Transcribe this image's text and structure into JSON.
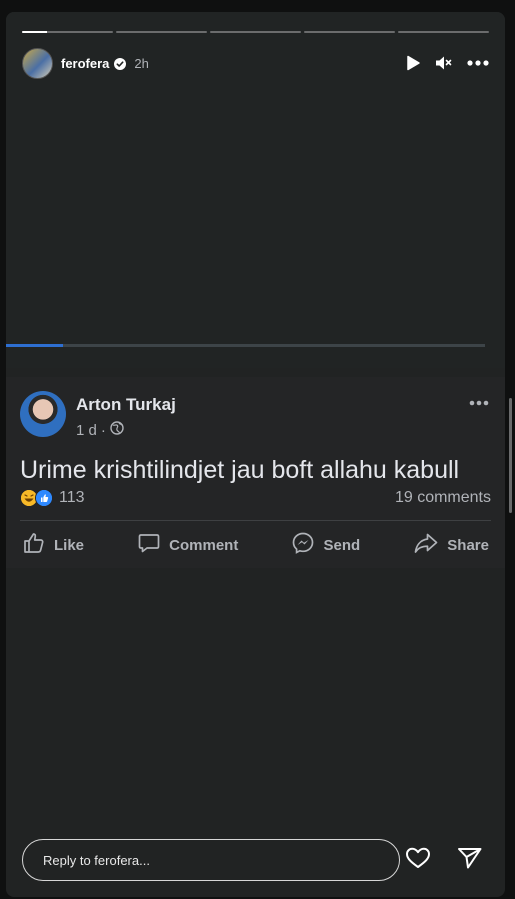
{
  "story": {
    "username": "ferofera",
    "time": "2h",
    "segments": [
      0.28,
      0,
      0,
      0,
      0
    ],
    "video_progress": 0.12,
    "colors": {
      "accent": "#2e6fd1",
      "background": "#212323"
    }
  },
  "post": {
    "author": "Arton Turkaj",
    "age": "1 d",
    "dot": "·",
    "text": "Urime krishtilindjet jau boft allahu kabull",
    "reaction_count": "113",
    "comments": "19 comments",
    "actions": {
      "like": "Like",
      "comment": "Comment",
      "send": "Send",
      "share": "Share"
    }
  },
  "reply": {
    "placeholder": "Reply to ferofera..."
  },
  "icons": [
    "verified-icon",
    "play-icon",
    "mute-icon",
    "more-icon",
    "globe-icon",
    "haha-reaction-icon",
    "like-reaction-icon",
    "thumbs-up-icon",
    "comment-icon",
    "messenger-icon",
    "share-icon",
    "heart-icon",
    "send-icon"
  ]
}
